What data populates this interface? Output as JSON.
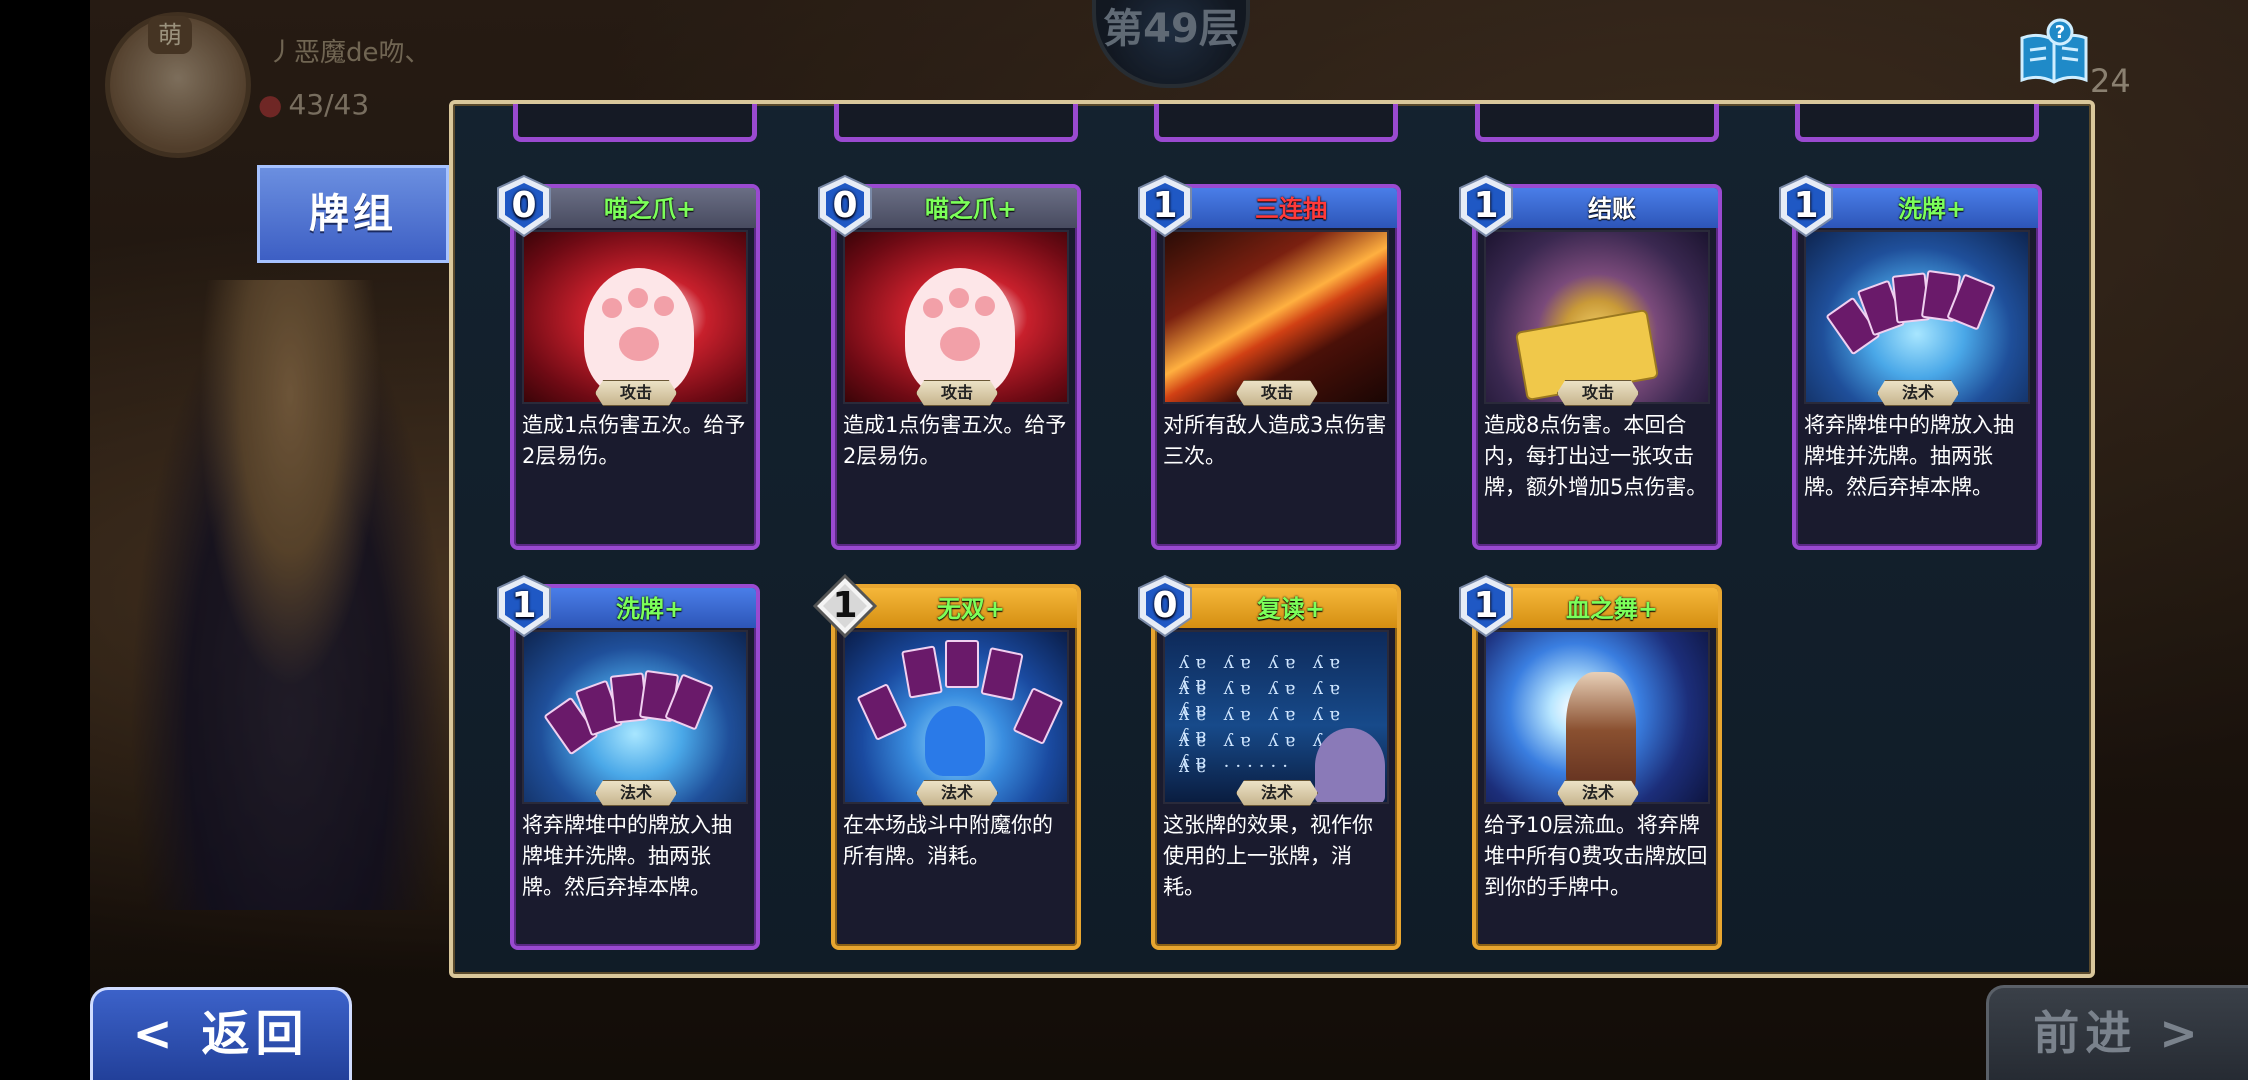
{
  "header": {
    "avatar_badge": "萌",
    "player_name": "丿恶魔de吻、",
    "hp": "43/43",
    "floor": "第49层",
    "gold": "24"
  },
  "tabs": {
    "deck_label": "牌组"
  },
  "nav": {
    "back_label": "< 返回",
    "forward_label": "前进 >"
  },
  "colors": {
    "purple_frame": "#9a4ad0",
    "gold_frame": "#e8a630",
    "blue_header": "#4a7ee8",
    "gray_header": "#6a6e84"
  },
  "cards": [
    {
      "cost": "0",
      "name": "喵之爪+",
      "type": "攻击",
      "desc": "造成1点伤害五次。给予2层易伤。",
      "frame": "purple",
      "header": "gray",
      "name_color": "green",
      "art": "claw-art"
    },
    {
      "cost": "0",
      "name": "喵之爪+",
      "type": "攻击",
      "desc": "造成1点伤害五次。给予2层易伤。",
      "frame": "purple",
      "header": "gray",
      "name_color": "green",
      "art": "claw-art"
    },
    {
      "cost": "1",
      "name": "三连抽",
      "type": "攻击",
      "desc": "对所有敌人造成3点伤害三次。",
      "frame": "purple",
      "header": "blue",
      "name_color": "red",
      "art": "triple-slash-art"
    },
    {
      "cost": "1",
      "name": "结账",
      "type": "攻击",
      "desc": "造成8点伤害。本回合内，每打出过一张攻击牌，额外增加5点伤害。",
      "frame": "purple",
      "header": "blue",
      "name_color": "white",
      "art": "checkout-art"
    },
    {
      "cost": "1",
      "name": "洗牌+",
      "type": "法术",
      "desc": "将弃牌堆中的牌放入抽牌堆并洗牌。抽两张牌。然后弃掉本牌。",
      "frame": "purple",
      "header": "blue",
      "name_color": "green",
      "art": "shuffle-art"
    },
    {
      "cost": "1",
      "name": "洗牌+",
      "type": "法术",
      "desc": "将弃牌堆中的牌放入抽牌堆并洗牌。抽两张牌。然后弃掉本牌。",
      "frame": "purple",
      "header": "blue",
      "name_color": "green",
      "art": "shuffle-art"
    },
    {
      "cost": "1",
      "name": "无双+",
      "type": "法术",
      "desc": "在本场战斗中附魔你的所有牌。消耗。",
      "frame": "gold",
      "header": "gold",
      "name_color": "green",
      "art": "musou-art",
      "cost_style": "diamond"
    },
    {
      "cost": "0",
      "name": "复读+",
      "type": "法术",
      "desc": "这张牌的效果，视作你使用的上一张牌，消耗。",
      "frame": "gold",
      "header": "gold",
      "name_color": "green",
      "art": "reread-art"
    },
    {
      "cost": "1",
      "name": "血之舞+",
      "type": "法术",
      "desc": "给予10层流血。将弃牌堆中所有0费攻击牌放回到你的手牌中。",
      "frame": "gold",
      "header": "gold",
      "name_color": "green",
      "art": "blood-dance-art"
    }
  ]
}
